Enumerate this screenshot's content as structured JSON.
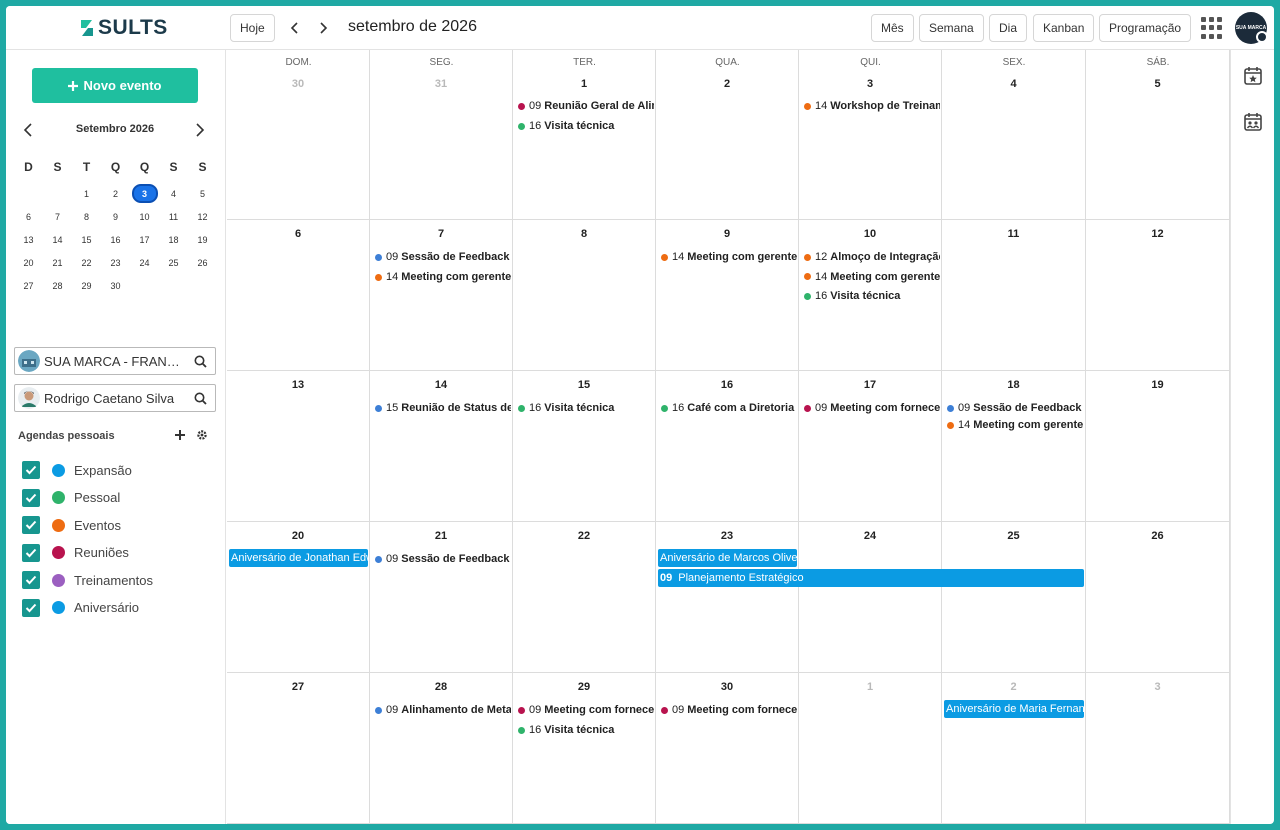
{
  "brand": {
    "logo_text": "SULTS",
    "avatar_text": "SUA MARCA"
  },
  "toolbar": {
    "today": "Hoje",
    "month_title": "setembro de 2026",
    "views": [
      "Mês",
      "Semana",
      "Dia",
      "Kanban",
      "Programação"
    ]
  },
  "sidebar": {
    "new_event": "Novo evento",
    "mini_title": "Setembro 2026",
    "mini_dow": [
      "D",
      "S",
      "T",
      "Q",
      "Q",
      "S",
      "S"
    ],
    "mini_weeks": [
      [
        "",
        "",
        "1",
        "2",
        "3",
        "4",
        "5"
      ],
      [
        "6",
        "7",
        "8",
        "9",
        "10",
        "11",
        "12"
      ],
      [
        "13",
        "14",
        "15",
        "16",
        "17",
        "18",
        "19"
      ],
      [
        "20",
        "21",
        "22",
        "23",
        "24",
        "25",
        "26"
      ],
      [
        "27",
        "28",
        "29",
        "30",
        "",
        "",
        ""
      ]
    ],
    "today": "3",
    "company_search": "SUA MARCA - FRANQUEADORA",
    "user_search": "Rodrigo Caetano Silva",
    "agendas_title": "Agendas pessoais",
    "agendas": [
      {
        "label": "Expansão",
        "color": "#0b9be3"
      },
      {
        "label": "Pessoal",
        "color": "#2fb36b"
      },
      {
        "label": "Eventos",
        "color": "#ee6c12"
      },
      {
        "label": "Reuniões",
        "color": "#b8134e"
      },
      {
        "label": "Treinamentos",
        "color": "#9b5fc0"
      },
      {
        "label": "Aniversário",
        "color": "#0b9be3"
      }
    ]
  },
  "colors": {
    "expansao": "#0b9be3",
    "pessoal": "#2fb36b",
    "eventos": "#ee6c12",
    "reunioes": "#b8134e",
    "feedback": "#3d7fd6",
    "accent": "#1fbf9f"
  },
  "calendar": {
    "dow": [
      "DOM.",
      "SEG.",
      "TER.",
      "QUA.",
      "QUI.",
      "SEX.",
      "SÁB."
    ],
    "weeks": [
      [
        {
          "day": "30",
          "other": true,
          "events": []
        },
        {
          "day": "31",
          "other": true,
          "events": []
        },
        {
          "day": "1",
          "events": [
            {
              "time": "09",
              "title": "Reunião Geral de Alinhamento",
              "color": "#b8134e"
            },
            {
              "time": "16",
              "title": "Visita técnica",
              "color": "#2fb36b"
            }
          ]
        },
        {
          "day": "2",
          "events": []
        },
        {
          "day": "3",
          "events": [
            {
              "time": "14",
              "title": "Workshop de Treinamento",
              "color": "#ee6c12"
            }
          ]
        },
        {
          "day": "4",
          "events": []
        },
        {
          "day": "5",
          "events": []
        }
      ],
      [
        {
          "day": "6",
          "events": []
        },
        {
          "day": "7",
          "events": [
            {
              "time": "09",
              "title": "Sessão de Feedback Coletivo",
              "color": "#3d7fd6"
            },
            {
              "time": "14",
              "title": "Meeting com gerente de vendas",
              "color": "#ee6c12"
            }
          ]
        },
        {
          "day": "8",
          "events": []
        },
        {
          "day": "9",
          "events": [
            {
              "time": "14",
              "title": "Meeting com gerente de vendas",
              "color": "#ee6c12"
            }
          ]
        },
        {
          "day": "10",
          "events": [
            {
              "time": "12",
              "title": "Almoço de Integração",
              "color": "#ee6c12"
            },
            {
              "time": "14",
              "title": "Meeting com gerente de vendas",
              "color": "#ee6c12"
            },
            {
              "time": "16",
              "title": "Visita técnica",
              "color": "#2fb36b"
            }
          ]
        },
        {
          "day": "11",
          "events": []
        },
        {
          "day": "12",
          "events": []
        }
      ],
      [
        {
          "day": "13",
          "events": []
        },
        {
          "day": "14",
          "events": [
            {
              "time": "15",
              "title": "Reunião de Status de Projeto",
              "color": "#3d7fd6"
            }
          ]
        },
        {
          "day": "15",
          "events": [
            {
              "time": "16",
              "title": "Visita técnica",
              "color": "#2fb36b"
            }
          ]
        },
        {
          "day": "16",
          "events": [
            {
              "time": "16",
              "title": "Café com a Diretoria",
              "color": "#2fb36b"
            }
          ]
        },
        {
          "day": "17",
          "events": [
            {
              "time": "09",
              "title": "Meeting com fornecedores",
              "color": "#b8134e"
            }
          ]
        },
        {
          "day": "18",
          "events": [
            {
              "time": "09",
              "title": "Sessão de Feedback Coletivo",
              "color": "#3d7fd6"
            },
            {
              "time": "14",
              "title": "Meeting com gerente de vendas",
              "color": "#ee6c12"
            }
          ]
        },
        {
          "day": "19",
          "events": []
        }
      ],
      [
        {
          "day": "20",
          "events": []
        },
        {
          "day": "21",
          "events": [
            {
              "time": "09",
              "title": "Sessão de Feedback Coletivo",
              "color": "#3d7fd6"
            }
          ]
        },
        {
          "day": "22",
          "events": []
        },
        {
          "day": "23",
          "events": []
        },
        {
          "day": "24",
          "events": []
        },
        {
          "day": "25",
          "events": []
        },
        {
          "day": "26",
          "events": []
        }
      ],
      [
        {
          "day": "27",
          "events": []
        },
        {
          "day": "28",
          "events": [
            {
              "time": "09",
              "title": "Alinhamento de Metas",
              "color": "#3d7fd6"
            }
          ]
        },
        {
          "day": "29",
          "events": [
            {
              "time": "09",
              "title": "Meeting com fornecedores",
              "color": "#b8134e"
            },
            {
              "time": "16",
              "title": "Visita técnica",
              "color": "#2fb36b"
            }
          ]
        },
        {
          "day": "30",
          "events": [
            {
              "time": "09",
              "title": "Meeting com fornecedores",
              "color": "#b8134e"
            }
          ]
        },
        {
          "day": "1",
          "other": true,
          "events": []
        },
        {
          "day": "2",
          "other": true,
          "events": []
        },
        {
          "day": "3",
          "other": true,
          "events": []
        }
      ]
    ],
    "bars": [
      {
        "week": 3,
        "start": 0,
        "span": 1,
        "row": 0,
        "time": "",
        "title": "Aniversário de Jonathan Edwards"
      },
      {
        "week": 3,
        "start": 3,
        "span": 1,
        "row": 0,
        "time": "",
        "title": "Aniversário de Marcos Oliveira"
      },
      {
        "week": 3,
        "start": 3,
        "span": 3,
        "row": 1,
        "time": "09",
        "title": "Planejamento Estratégico"
      },
      {
        "week": 4,
        "start": 5,
        "span": 1,
        "row": 0,
        "time": "",
        "title": "Aniversário de Maria Fernanda"
      }
    ]
  }
}
